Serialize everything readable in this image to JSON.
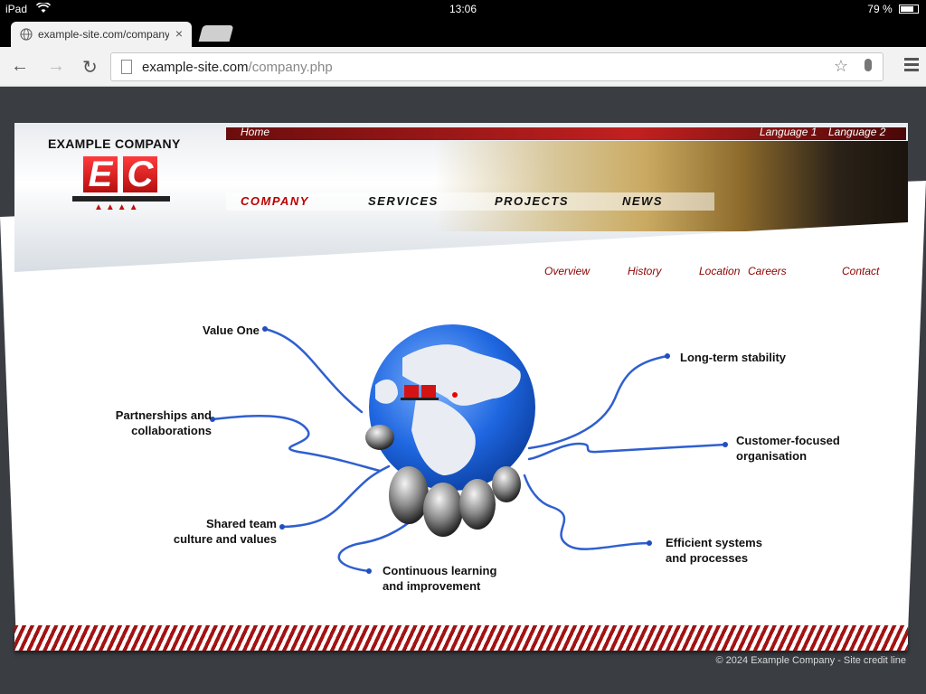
{
  "status": {
    "device": "iPad",
    "wifi": "wifi-icon",
    "time": "13:06",
    "battery": "79 %"
  },
  "tabs": {
    "active_label": "example-site.com/company",
    "close": "×"
  },
  "toolbar": {
    "url_host": "example-site.com",
    "url_path": "/company.php"
  },
  "site": {
    "brand": "EXAMPLE COMPANY",
    "logo_letters": [
      "E",
      "C"
    ],
    "logo_tris": "▲▲▲▲",
    "top_links": {
      "home": "Home",
      "lang1": "Language 1",
      "lang2": "Language 2"
    },
    "nav": [
      "COMPANY",
      "SERVICES",
      "PROJECTS",
      "NEWS"
    ],
    "subnav": [
      "Overview",
      "History",
      "Location",
      "Careers",
      "Contact"
    ],
    "diagram": [
      "Value One",
      "Partnerships and\ncollaborations",
      "Shared team\nculture and values",
      "Continuous learning\nand improvement",
      "Long-term stability",
      "Customer-focused\norganisation",
      "Efficient systems\nand processes"
    ],
    "footer": "© 2024 Example Company - Site credit line"
  },
  "colors": {
    "accent": "#b00000",
    "link": "#8b0000"
  }
}
